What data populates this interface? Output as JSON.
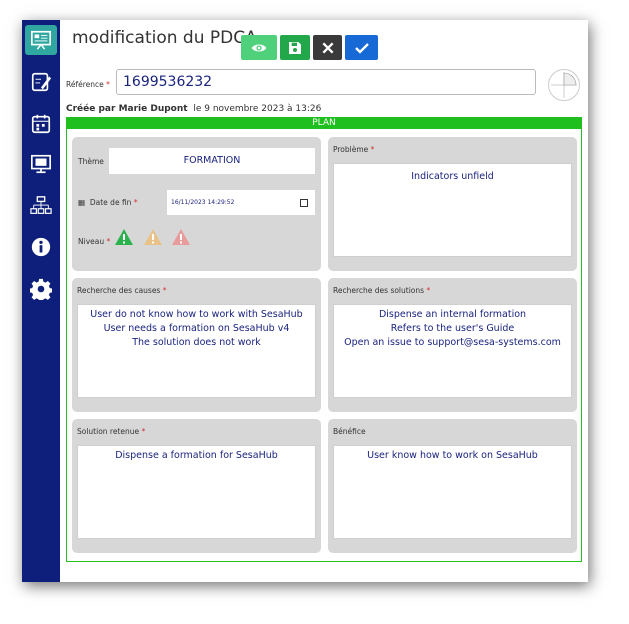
{
  "header": {
    "title": "modification du PDCA"
  },
  "toolbar": {
    "view": {
      "icon": "eye-icon",
      "color": "#4fd17c"
    },
    "save": {
      "icon": "save-icon",
      "color": "#22a84a"
    },
    "cancel": {
      "icon": "close-icon",
      "color": "#3a3a3a"
    },
    "confirm": {
      "icon": "check-icon",
      "color": "#1769d6"
    }
  },
  "reference": {
    "label": "Référence",
    "required": "*",
    "value": "1699536232"
  },
  "created": {
    "label": "Créée par Marie Dupont",
    "date": "le 9 novembre 2023 à 13:26"
  },
  "plan": {
    "title": "PLAN",
    "accent": "#1fbf1f"
  },
  "theme": {
    "label": "Thème",
    "value": "FORMATION"
  },
  "end_date": {
    "label": "Date de fin",
    "required": "*",
    "value": "16/11/2023 14:29:52"
  },
  "level": {
    "label": "Niveau",
    "required": "*"
  },
  "problem": {
    "label": "Problème",
    "required": "*",
    "text": "Indicators unfield"
  },
  "causes": {
    "label": "Recherche des causes",
    "required": "*",
    "lines": [
      "User do not know how to work with SesaHub",
      "User needs a formation on SesaHub v4",
      "The solution does not work"
    ]
  },
  "solutions": {
    "label": "Recherche des solutions",
    "required": "*",
    "lines": [
      "Dispense an internal formation",
      "Refers to the user's Guide",
      "Open an issue to support@sesa-systems.com"
    ]
  },
  "retained": {
    "label": "Solution retenue",
    "required": "*",
    "text": "Dispense a formation for SesaHub"
  },
  "benefit": {
    "label": "Bénéfice",
    "text": "User know how to work on SesaHub"
  },
  "sidebar": {
    "items": [
      "dashboard-icon",
      "document-edit-icon",
      "calendar-icon",
      "presentation-icon",
      "org-chart-icon",
      "info-icon",
      "gear-icon"
    ]
  },
  "colors": {
    "sidebar": "#0d1f7a",
    "active": "#2fa7a0",
    "text_value": "#1a237e",
    "required": "#d32f2f"
  }
}
